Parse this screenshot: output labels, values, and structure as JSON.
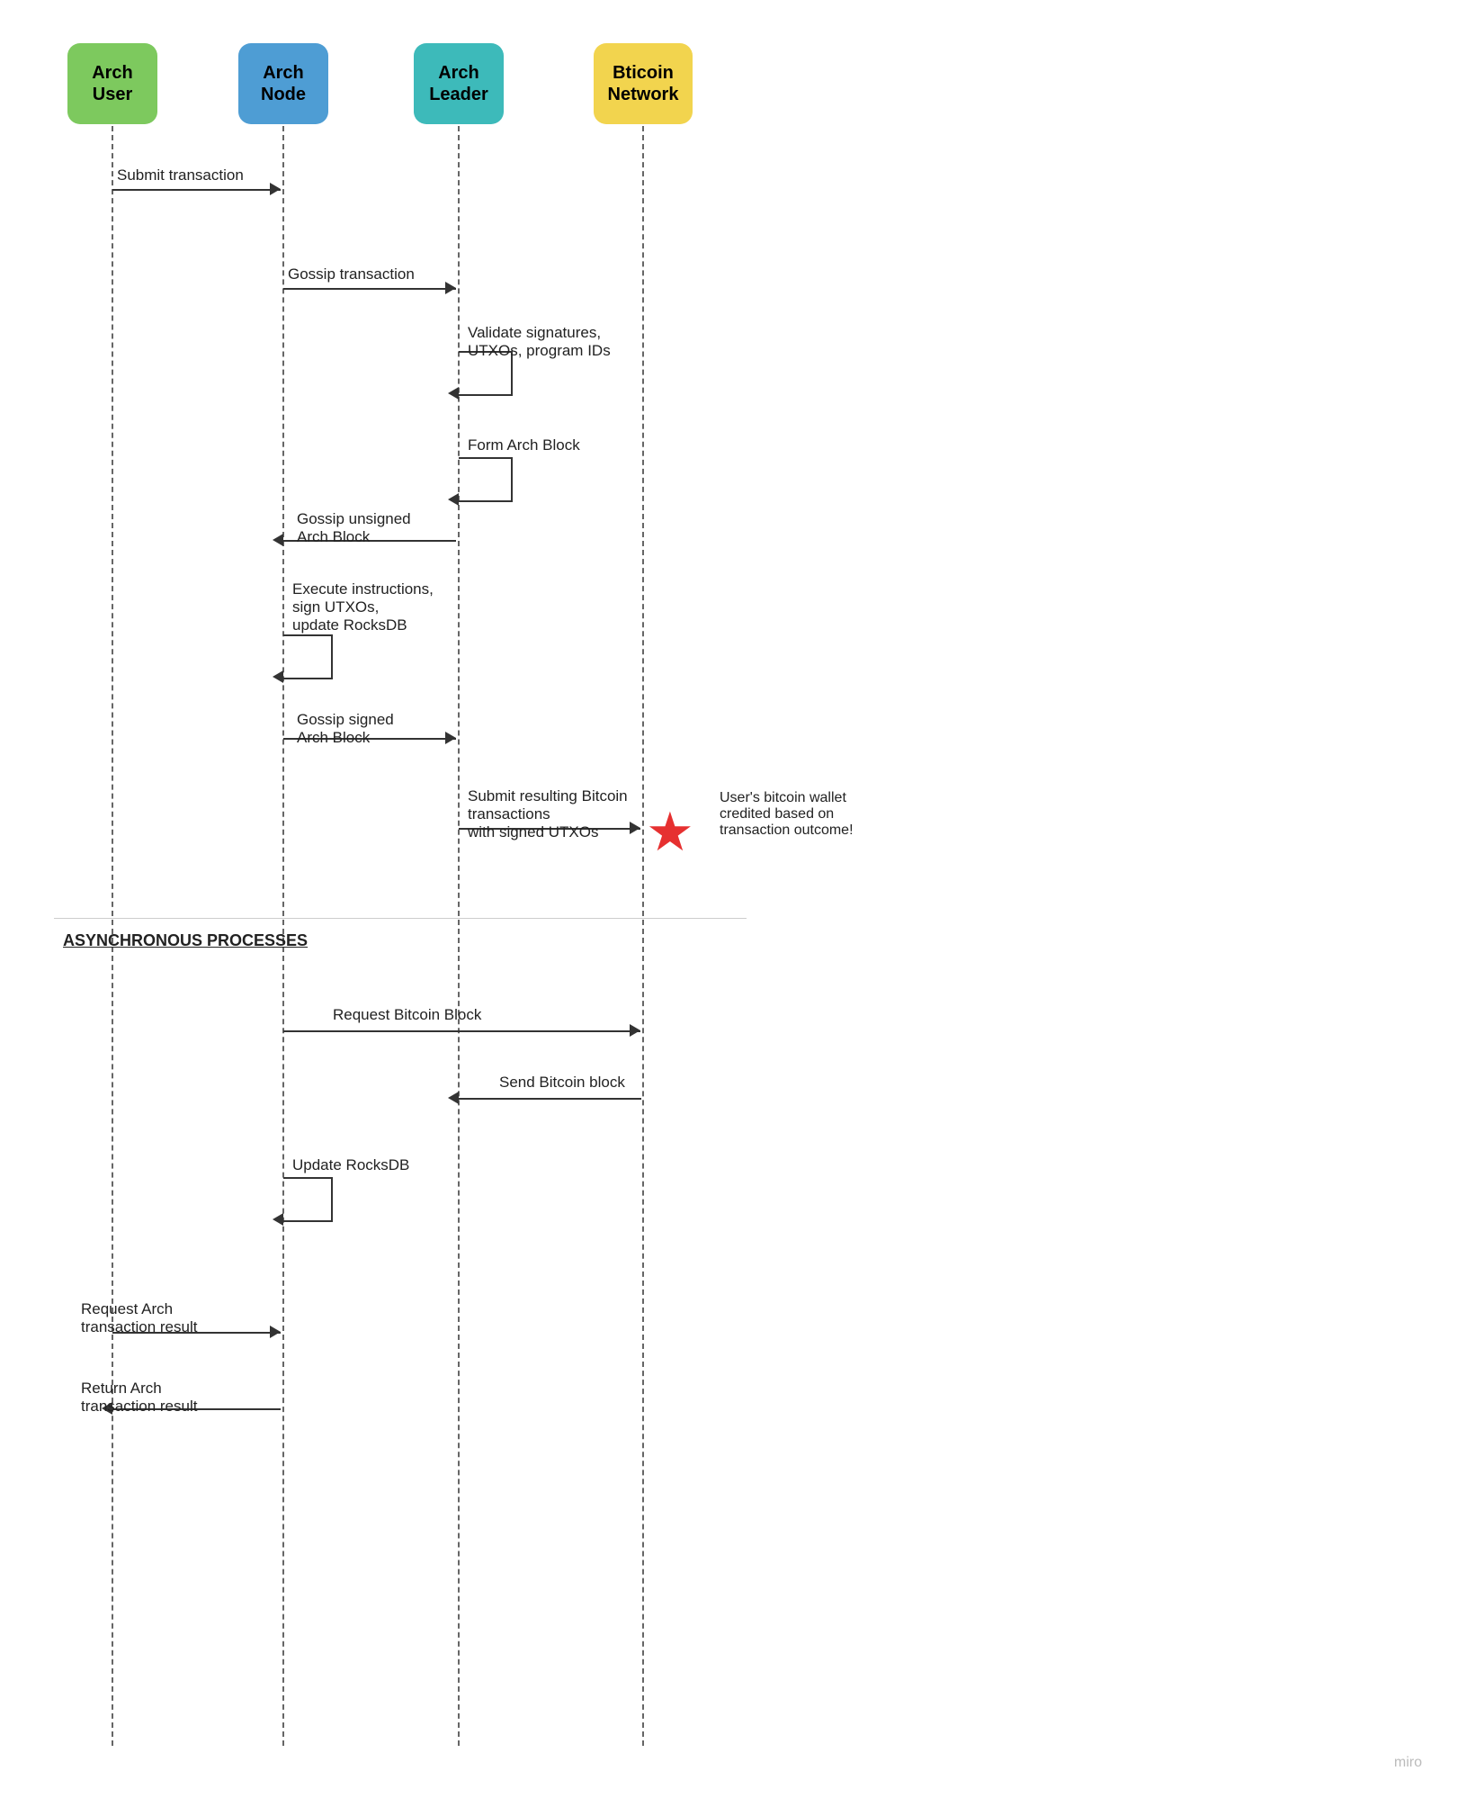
{
  "actors": {
    "user": {
      "label": "Arch\nUser",
      "color": "#7dc95e"
    },
    "node": {
      "label": "Arch\nNode",
      "color": "#4e9dd4"
    },
    "leader": {
      "label": "Arch\nLeader",
      "color": "#3dbaba"
    },
    "bitcoin": {
      "label": "Bitcoin\nNetwork",
      "color": "#f2d44e"
    }
  },
  "messages": {
    "submit_transaction": "Submit transaction",
    "gossip_transaction": "Gossip transaction",
    "validate": "Validate signatures,\nUTXOs, program IDs",
    "form_arch_block": "Form Arch Block",
    "gossip_unsigned": "Gossip unsigned\nArch Block",
    "execute_instructions": "Execute instructions,\nsign UTXOs,\nupdate RocksDB",
    "gossip_signed": "Gossip signed\nArch Block",
    "submit_bitcoin": "Submit resulting Bitcoin\ntransactions\nwith signed UTXOs",
    "wallet_credit": "User's bitcoin wallet\ncredited based on\ntransaction outcome!",
    "async_label": "ASYNCHRONOUS PROCESSES",
    "request_bitcoin": "Request Bitcoin Block",
    "send_bitcoin": "Send Bitcoin block",
    "update_rocks": "Update RocksDB",
    "request_arch": "Request Arch\ntransaction result",
    "return_arch": "Return Arch\ntransaction result"
  },
  "watermark": "miro"
}
